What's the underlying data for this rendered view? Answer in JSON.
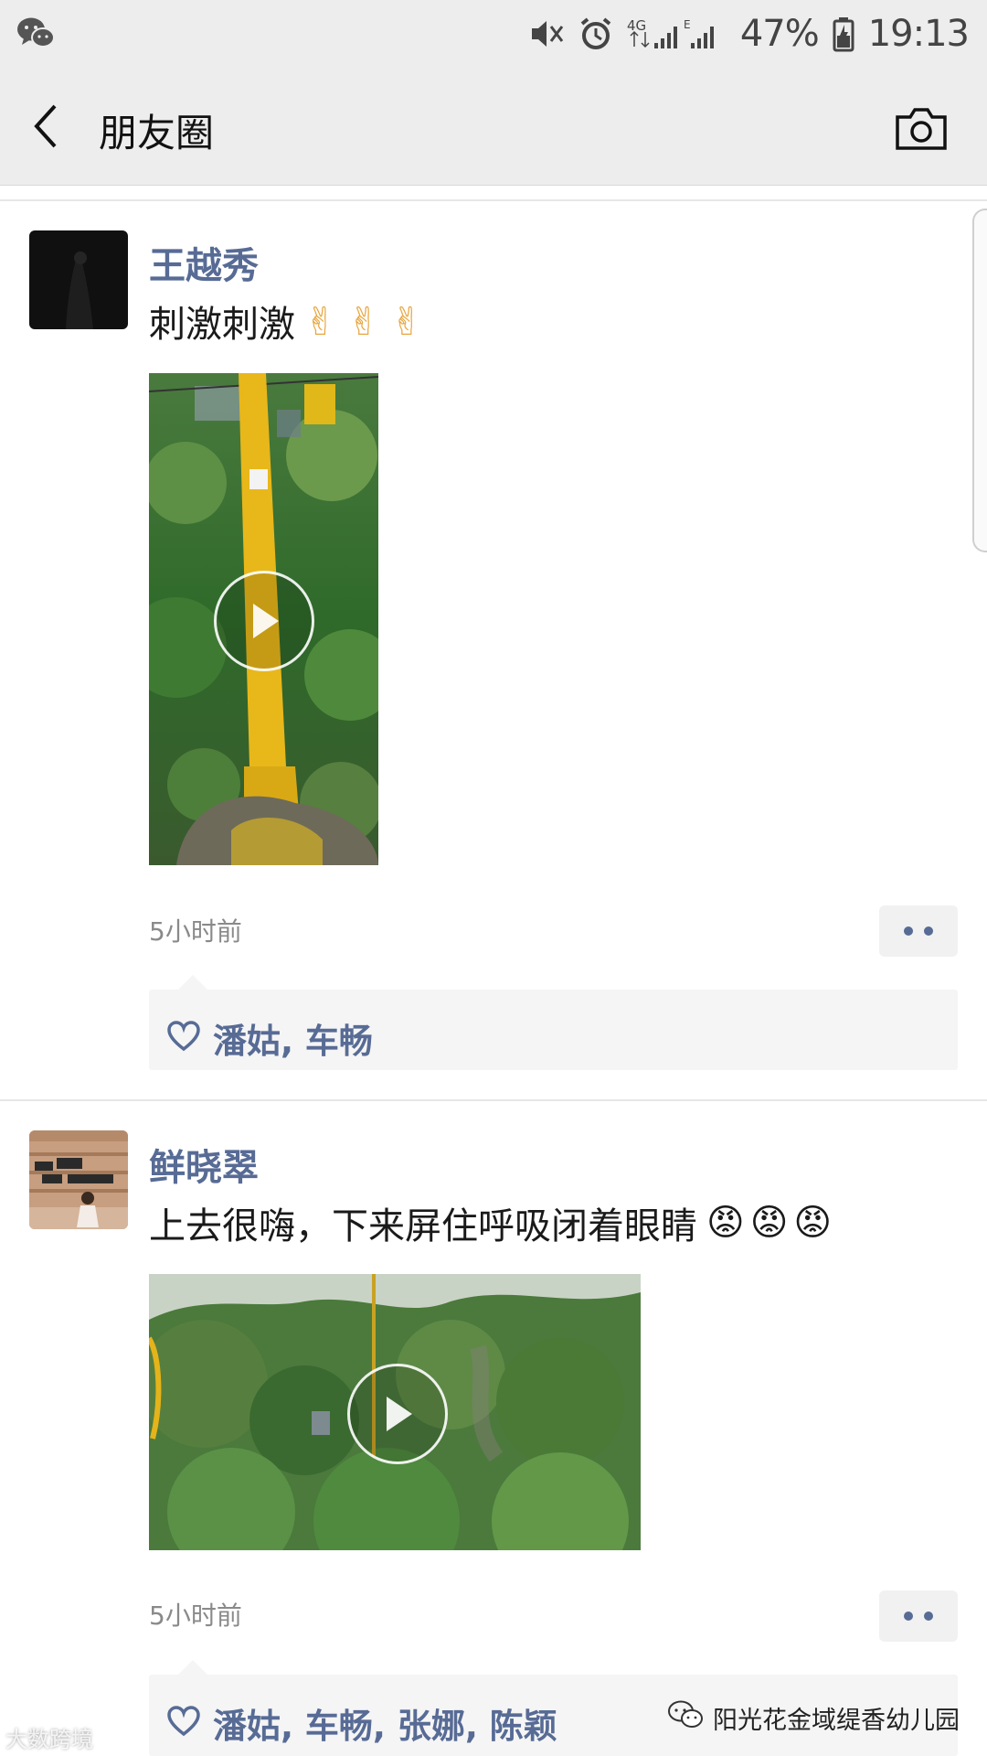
{
  "status_bar": {
    "battery": "47%",
    "time": "19:13",
    "network": "4G",
    "icons": [
      "wechat-icon",
      "mute-icon",
      "alarm-icon",
      "signal-icon",
      "battery-icon"
    ]
  },
  "nav": {
    "title": "朋友圈",
    "icons": [
      "back-arrow-icon",
      "camera-icon"
    ]
  },
  "posts": [
    {
      "author": "王越秀",
      "text": "刺激刺激",
      "emoji": "✌✌✌",
      "timestamp": "5小时前",
      "likes": "潘姑, 车畅"
    },
    {
      "author": "鲜晓翠",
      "text": "上去很嗨，下来屏住呼吸闭着眼睛",
      "emoji": "😡😡😡",
      "timestamp": "5小时前",
      "likes": "潘姑, 车畅, 张娜, 陈颖"
    }
  ],
  "watermarks": {
    "left": "大数跨境",
    "right": "阳光花金域缇香幼儿园"
  }
}
